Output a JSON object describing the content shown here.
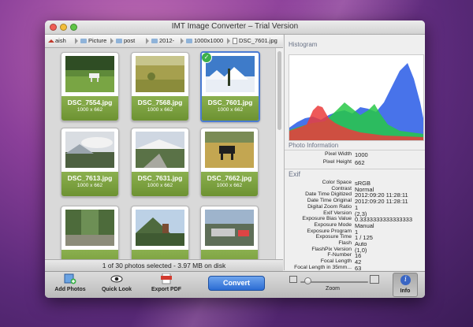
{
  "window": {
    "title": "IMT Image Converter – Trial Version"
  },
  "breadcrumb": [
    "aish",
    "Picture",
    "post",
    "2012-",
    "1000x1000",
    "DSC_7601.jpg"
  ],
  "photos": [
    {
      "name": "DSC_7554.jpg",
      "dims": "1000 x 662",
      "selected": false
    },
    {
      "name": "DSC_7568.jpg",
      "dims": "1000 x 662",
      "selected": false
    },
    {
      "name": "DSC_7601.jpg",
      "dims": "1000 x 662",
      "selected": true
    },
    {
      "name": "DSC_7613.jpg",
      "dims": "1000 x 662",
      "selected": false
    },
    {
      "name": "DSC_7631.jpg",
      "dims": "1000 x 662",
      "selected": false
    },
    {
      "name": "DSC_7662.jpg",
      "dims": "1000 x 662",
      "selected": false
    },
    {
      "name": "",
      "dims": "",
      "selected": false
    },
    {
      "name": "",
      "dims": "",
      "selected": false
    },
    {
      "name": "",
      "dims": "",
      "selected": false
    }
  ],
  "status": {
    "text": "1 of 30 photos selected - 3.97 MB on disk"
  },
  "panel": {
    "histogram_heading": "Histogram",
    "photo_info_heading": "Photo Information",
    "photo_info": [
      {
        "key": "Pixel Width",
        "value": "1000"
      },
      {
        "key": "Pixel Height",
        "value": "662"
      }
    ],
    "exif_heading": "Exif",
    "exif": [
      {
        "key": "Color Space",
        "value": "sRGB"
      },
      {
        "key": "Contrast",
        "value": "Normal"
      },
      {
        "key": "Date Time Digitized",
        "value": "2012:09:20 11:28:11"
      },
      {
        "key": "Date Time Original",
        "value": "2012:09:20 11:28:11"
      },
      {
        "key": "Digital Zoom Ratio",
        "value": "1"
      },
      {
        "key": "Exif Version",
        "value": "(2,3)"
      },
      {
        "key": "Exposure Bias Value",
        "value": "0.3333333333333333"
      },
      {
        "key": "Exposure Mode",
        "value": "Manual"
      },
      {
        "key": "Exposure Program",
        "value": "1"
      },
      {
        "key": "Exposure Time",
        "value": "1 / 125"
      },
      {
        "key": "Flash",
        "value": "Auto"
      },
      {
        "key": "FlashPix Version",
        "value": "(1,0)"
      },
      {
        "key": "F-Number",
        "value": "16"
      },
      {
        "key": "Focal Length",
        "value": "42"
      },
      {
        "key": "Focal Length in 35mm...",
        "value": "63"
      }
    ]
  },
  "toolbar": {
    "add_photos": "Add Photos",
    "quick_look": "Quick Look",
    "export_pdf": "Export PDF",
    "convert": "Convert",
    "zoom": "Zoom",
    "zoom_level": 0.1,
    "info": "Info"
  },
  "colors": {
    "accent": "#2b6cd3",
    "caption": "#7aa03e",
    "selection": "#4a7bd2"
  }
}
